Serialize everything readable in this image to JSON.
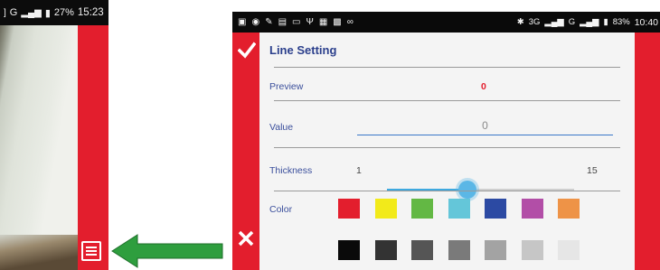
{
  "left_phone": {
    "status": {
      "signal": "G",
      "battery": "27%",
      "time": "15:23"
    }
  },
  "right_phone": {
    "status": {
      "network": "3G",
      "signal": "G",
      "battery": "83%",
      "time": "10:40"
    },
    "dialog": {
      "title": "Line Setting",
      "preview": {
        "label": "Preview",
        "value": "0"
      },
      "value_field": {
        "label": "Value",
        "placeholder": "0"
      },
      "thickness": {
        "label": "Thickness",
        "min": "1",
        "max": "15",
        "current": 7
      },
      "color": {
        "label": "Color",
        "row1": [
          "#e31e2d",
          "#f2ea1a",
          "#63b844",
          "#64c6d9",
          "#2c4aa3",
          "#b24ea7",
          "#ee9347"
        ],
        "row2": [
          "#0a0a0a",
          "#333333",
          "#555555",
          "#7a7a7a",
          "#a3a3a3",
          "#c6c6c6",
          "#e6e6e6"
        ]
      }
    }
  },
  "colors": {
    "accent_red": "#e31e2d",
    "title_blue": "#2b3f8c",
    "slider_blue": "#3fa9df",
    "arrow_green": "#2e9e3e"
  }
}
